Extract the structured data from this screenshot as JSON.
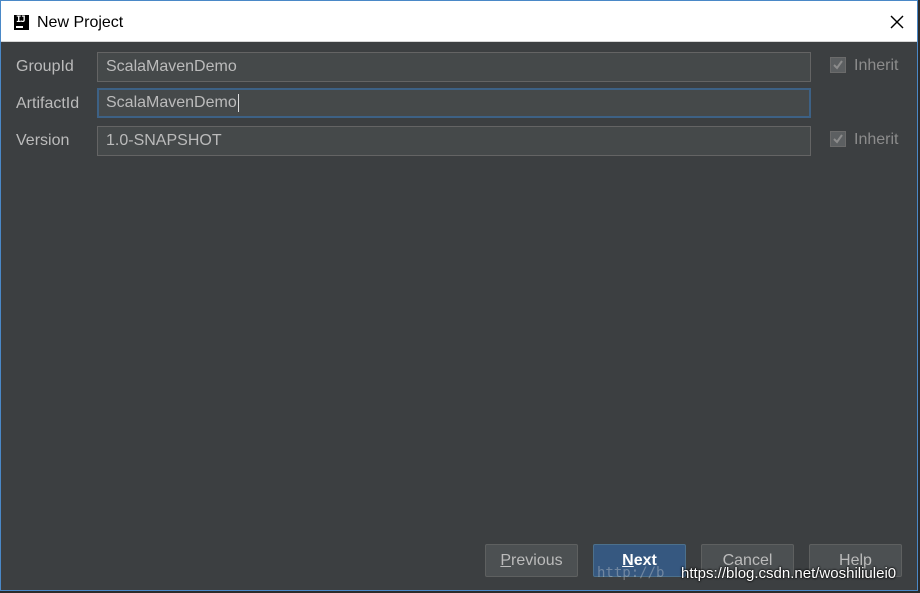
{
  "window": {
    "title": "New Project",
    "icon": "intellij-icon",
    "close_icon": "close-icon"
  },
  "form": {
    "group_id": {
      "label": "GroupId",
      "value": "ScalaMavenDemo",
      "inherit_label": "Inherit",
      "inherit_checked": true
    },
    "artifact_id": {
      "label": "ArtifactId",
      "value": "ScalaMavenDemo"
    },
    "version": {
      "label": "Version",
      "value": "1.0-SNAPSHOT",
      "inherit_label": "Inherit",
      "inherit_checked": true
    }
  },
  "buttons": {
    "previous_mnemonic": "P",
    "previous_rest": "revious",
    "next_mnemonic": "N",
    "next_rest": "ext",
    "cancel": "Cancel",
    "help": "Help"
  },
  "watermark": {
    "faint": "http://b",
    "text": "https://blog.csdn.net/woshiliulei0"
  },
  "colors": {
    "dialog_bg": "#3c3f41",
    "field_bg": "#45494a",
    "primary_button": "#365880",
    "focus_border": "#3d6185"
  }
}
